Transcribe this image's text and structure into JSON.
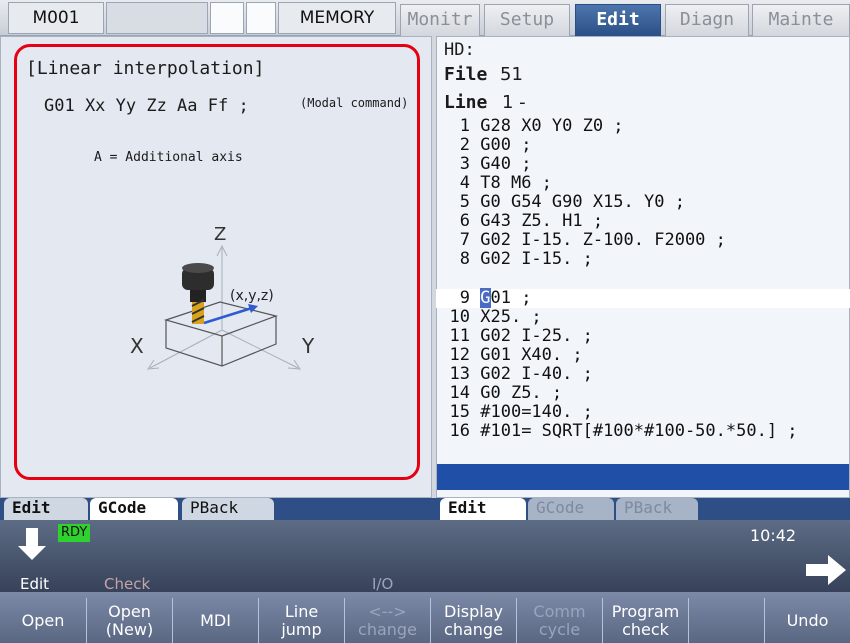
{
  "status_bar": {
    "alarm": "M001",
    "mode": "MEMORY"
  },
  "tabs": [
    {
      "label": "Monitr"
    },
    {
      "label": "Setup"
    },
    {
      "label": "Edit"
    },
    {
      "label": "Diagn"
    },
    {
      "label": "Mainte"
    }
  ],
  "guide": {
    "title": "[Linear interpolation]",
    "format": "G01 Xx Yy Zz Aa Ff ;",
    "note": "(Modal command)",
    "axis_note": "A = Additional axis",
    "diagram": {
      "z": "Z",
      "x": "X",
      "y": "Y",
      "point": "(x,y,z)"
    }
  },
  "editor": {
    "device": "HD:",
    "file_label": "File",
    "file_value": "51",
    "line_label": "Line",
    "line_value": "1 -",
    "lines": [
      {
        "n": "1",
        "code": "G28 X0 Y0 Z0 ;"
      },
      {
        "n": "2",
        "code": "G00 ;"
      },
      {
        "n": "3",
        "code": "G40 ;"
      },
      {
        "n": "4",
        "code": "T8 M6 ;"
      },
      {
        "n": "5",
        "code": "G0 G54 G90 X15. Y0 ;"
      },
      {
        "n": "6",
        "code": "G43 Z5. H1 ;"
      },
      {
        "n": "7",
        "code": "G02 I-15. Z-100. F2000 ;"
      },
      {
        "n": "8",
        "code": "G02 I-15. ;"
      },
      {
        "n": "9",
        "cursor": "G",
        "code": "01 ;"
      },
      {
        "n": "10",
        "code": "X25. ;"
      },
      {
        "n": "11",
        "code": "G02 I-25. ;"
      },
      {
        "n": "12",
        "code": "G01 X40. ;"
      },
      {
        "n": "13",
        "code": "G02 I-40. ;"
      },
      {
        "n": "14",
        "code": "G0 Z5. ;"
      },
      {
        "n": "15",
        "code": "#100=140. ;"
      },
      {
        "n": "16",
        "code": "#101= SQRT[#100*#100-50.*50.] ;"
      }
    ]
  },
  "left_tabs": [
    {
      "label": "Edit"
    },
    {
      "label": "GCode"
    },
    {
      "label": "PBack"
    }
  ],
  "right_tabs": [
    {
      "label": "Edit"
    },
    {
      "label": "GCode"
    },
    {
      "label": "PBack"
    }
  ],
  "status": {
    "ready": "RDY",
    "time": "10:42"
  },
  "menu": {
    "edit": "Edit",
    "check": "Check",
    "io": "I/O"
  },
  "function_keys": [
    {
      "line1": "Open",
      "line2": "",
      "enabled": true
    },
    {
      "line1": "Open",
      "line2": "(New)",
      "enabled": true
    },
    {
      "line1": "MDI",
      "line2": "",
      "enabled": true
    },
    {
      "line1": "Line",
      "line2": "jump",
      "enabled": true
    },
    {
      "line1": "<-->",
      "line2": "change",
      "enabled": false
    },
    {
      "line1": "Display",
      "line2": "change",
      "enabled": true
    },
    {
      "line1": "Comm",
      "line2": "cycle",
      "enabled": false
    },
    {
      "line1": "Program",
      "line2": "check",
      "enabled": true
    },
    {
      "line1": "",
      "line2": "",
      "enabled": true
    },
    {
      "line1": "Undo",
      "line2": "",
      "enabled": true
    }
  ],
  "colors": {
    "highlight": "#e60012",
    "accent": "#2a4f86",
    "ready": "#22cc22"
  }
}
